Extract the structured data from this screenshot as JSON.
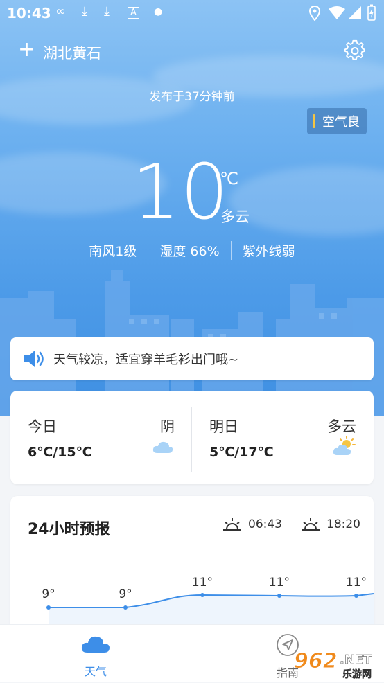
{
  "status_bar": {
    "time": "10:43"
  },
  "header": {
    "city": "湖北黄石"
  },
  "published": "发布于37分钟前",
  "air_quality": {
    "label": "空气良"
  },
  "current": {
    "temperature": "10",
    "unit": "℃",
    "condition": "多云",
    "wind": "南风1级",
    "humidity": "湿度 66%",
    "uv": "紫外线弱"
  },
  "tip": {
    "text": "天气较凉，适宜穿羊毛衫出门哦~"
  },
  "daily": [
    {
      "name": "今日",
      "condition": "阴",
      "temps": "6℃/15℃",
      "icon": "cloud-icon"
    },
    {
      "name": "明日",
      "condition": "多云",
      "temps": "5℃/17℃",
      "icon": "partly-cloudy-icon"
    }
  ],
  "hourly": {
    "title": "24小时预报",
    "sunrise": "06:43",
    "sunset": "18:20",
    "temps": [
      "9°",
      "9°",
      "11°",
      "11°",
      "11°"
    ]
  },
  "nav": {
    "weather": "天气",
    "guide": "指南"
  },
  "watermark": {
    "text1": "962",
    "text2": ".NET",
    "text3": "乐游网"
  },
  "colors": {
    "accent": "#3d8ee8",
    "sky_top": "#8cc3f4",
    "sky_bottom": "#3f8fe2",
    "aq_bar": "#f5c542"
  }
}
